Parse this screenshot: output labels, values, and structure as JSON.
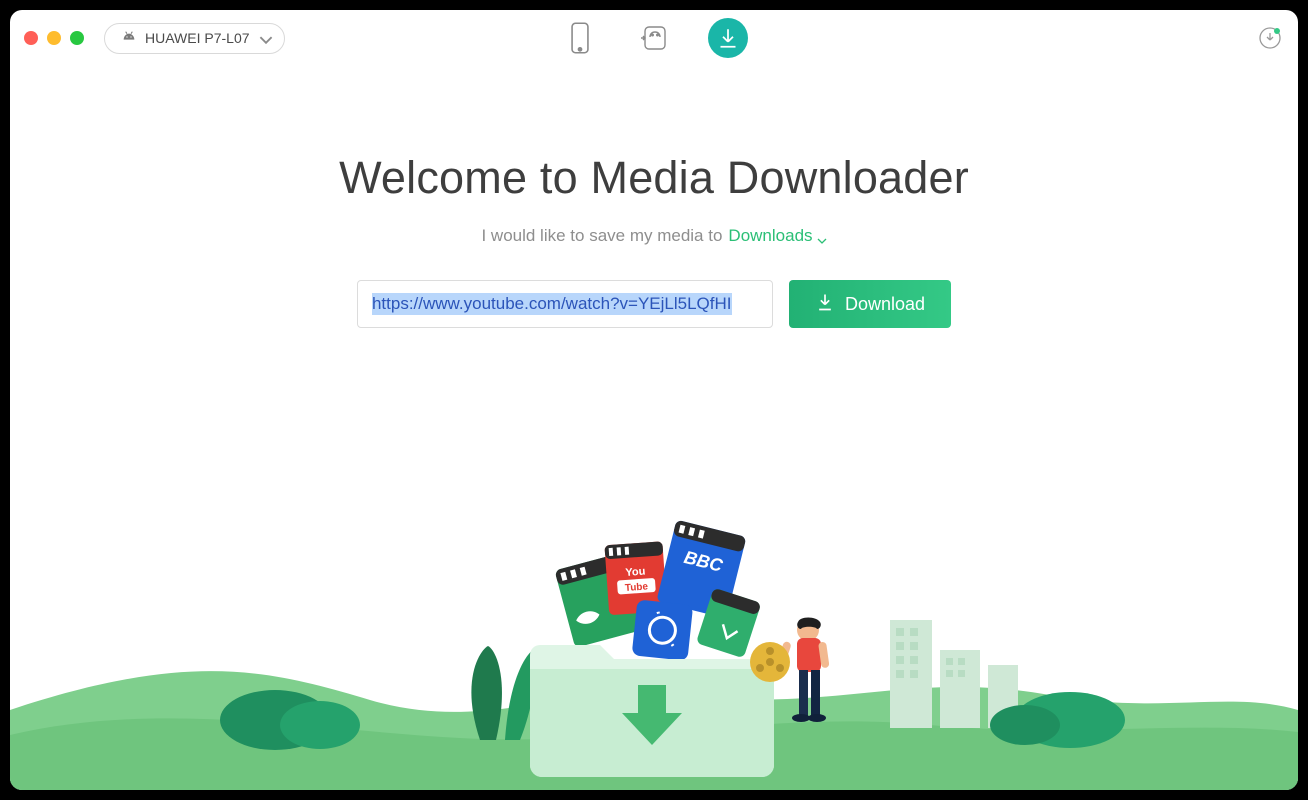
{
  "device": {
    "label": "HUAWEI P7-L07"
  },
  "nav": {
    "phone_icon": "phone-icon",
    "android_icon": "android-transfer-icon",
    "download_icon": "download-circle-icon"
  },
  "header": {
    "title": "Welcome to Media Downloader",
    "subtitle_prefix": "I would like to save my media to",
    "folder_label": "Downloads"
  },
  "input": {
    "url_value": "https://www.youtube.com/watch?v=YEjLl5LQfHI"
  },
  "actions": {
    "download_label": "Download"
  },
  "colors": {
    "accent_teal": "#1ab6a8",
    "accent_green_start": "#22b174",
    "accent_green_end": "#34c986",
    "link_green": "#2bbf76",
    "url_highlight_bg": "#b8d6fb",
    "url_highlight_fg": "#2b54b9"
  }
}
